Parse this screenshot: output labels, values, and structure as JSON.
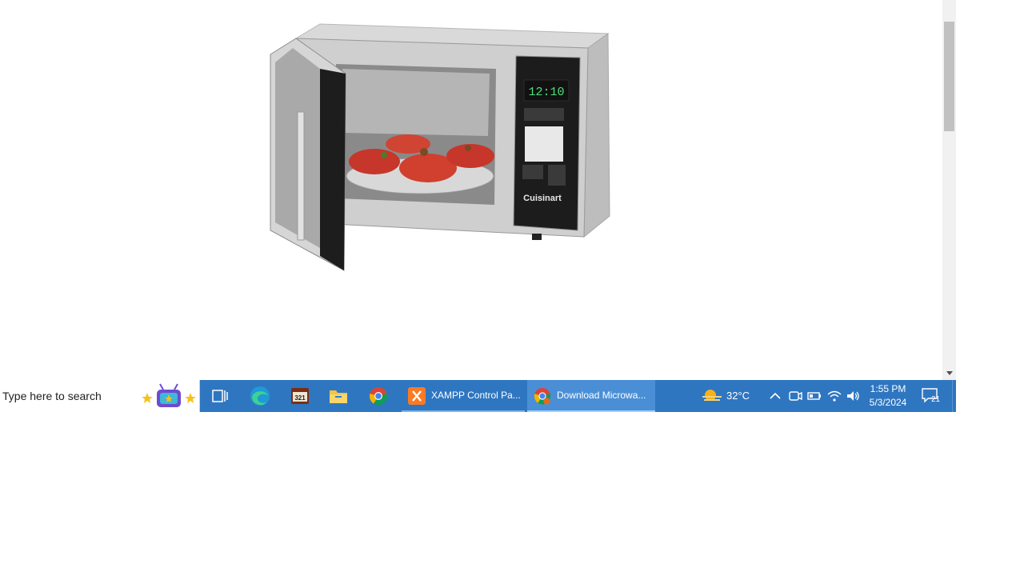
{
  "product_image": {
    "alt": "Stainless steel microwave oven with open door"
  },
  "microwave": {
    "display_time": "12:10",
    "brand": "Cuisinart"
  },
  "taskbar": {
    "search_placeholder": "Type here to search",
    "pinned": [
      "task-view-icon",
      "edge-icon",
      "media-player-icon",
      "file-explorer-icon",
      "chrome-icon"
    ],
    "apps": [
      {
        "label": "XAMPP Control Pa...",
        "icon": "xampp-icon"
      },
      {
        "label": "Download Microwa...",
        "icon": "chrome-icon",
        "active": true
      }
    ],
    "weather": {
      "temp": "32°C",
      "icon": "sun-haze-icon"
    },
    "clock": {
      "time": "1:55 PM",
      "date": "5/3/2024"
    },
    "notifications": {
      "count": "21"
    }
  },
  "colors": {
    "taskbar": "#2f76c1",
    "active_app": "#4a8fd6",
    "scroll_thumb": "#c1c1c1"
  }
}
